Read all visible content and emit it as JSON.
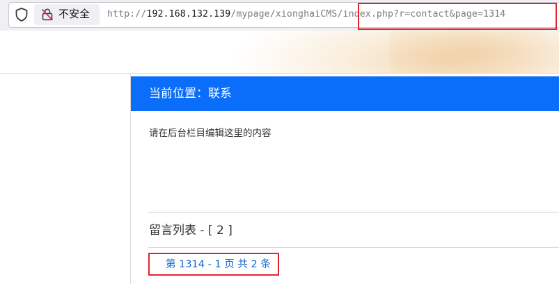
{
  "browser": {
    "security_label": "不安全",
    "url_scheme": "http://",
    "url_host": "192.168.132.139",
    "url_path": "/mypage/xionghaiCMS/index.php?r=contact&page=1314",
    "icons": {
      "tracking_protection": "shield-icon",
      "insecure_connection": "lock-off-icon"
    },
    "highlight_color": "#e3232b"
  },
  "page": {
    "location_label": "当前位置：联系",
    "content_text": "请在后台栏目编辑这里的内容",
    "guestbook_title": "留言列表 - [ 2 ]",
    "pagination": "第 1314 - 1 页 共 2 条",
    "accent_color": "#0b6efb",
    "link_color": "#1166cc"
  }
}
